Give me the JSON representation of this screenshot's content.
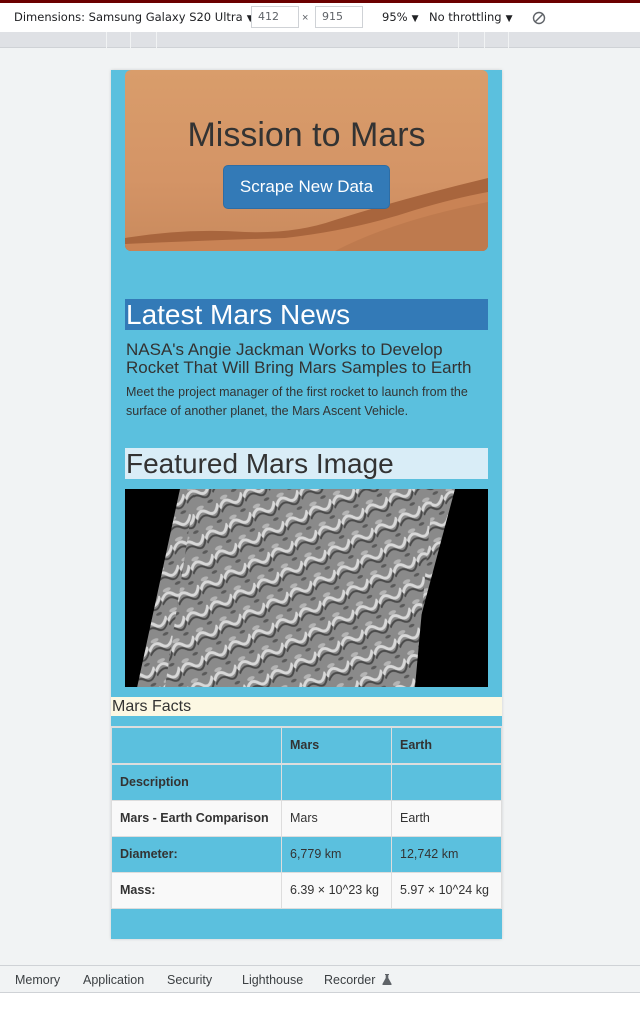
{
  "devtools": {
    "device_label": "Dimensions: Samsung Galaxy S20 Ultra",
    "width_value": "412",
    "height_value": "915",
    "times": "×",
    "zoom": "95%",
    "throttling": "No throttling",
    "caret": "▼",
    "bottom_tabs": [
      "Memory",
      "Application",
      "Security",
      "Lighthouse",
      "Recorder"
    ]
  },
  "page": {
    "jumbotron": {
      "title": "Mission to Mars",
      "button_label": "Scrape New Data"
    },
    "news": {
      "heading": "Latest Mars News",
      "title": "NASA's Angie Jackman Works to Develop Rocket That Will Bring Mars Samples to Earth",
      "teaser": "Meet the project manager of the first rocket to launch from the surface of another planet, the Mars Ascent Vehicle."
    },
    "featured": {
      "heading": "Featured Mars Image"
    },
    "facts": {
      "heading": "Mars Facts",
      "columns": [
        "",
        "Mars",
        "Earth"
      ],
      "index_label": "Description",
      "rows": [
        {
          "label": "Mars - Earth Comparison",
          "mars": "Mars",
          "earth": "Earth"
        },
        {
          "label": "Diameter:",
          "mars": "6,779 km",
          "earth": "12,742 km"
        },
        {
          "label": "Mass:",
          "mars": "6.39 × 10^23 kg",
          "earth": "5.97 × 10^24 kg"
        }
      ]
    }
  },
  "colors": {
    "info": "#5bc0de",
    "primary": "#337ab7",
    "info_light": "#d9edf7",
    "warning_light": "#fcf8e3"
  },
  "icons": {
    "caret": "chevron-down-icon",
    "sensors": "no-sensor-icon",
    "recorder": "flask-icon"
  }
}
